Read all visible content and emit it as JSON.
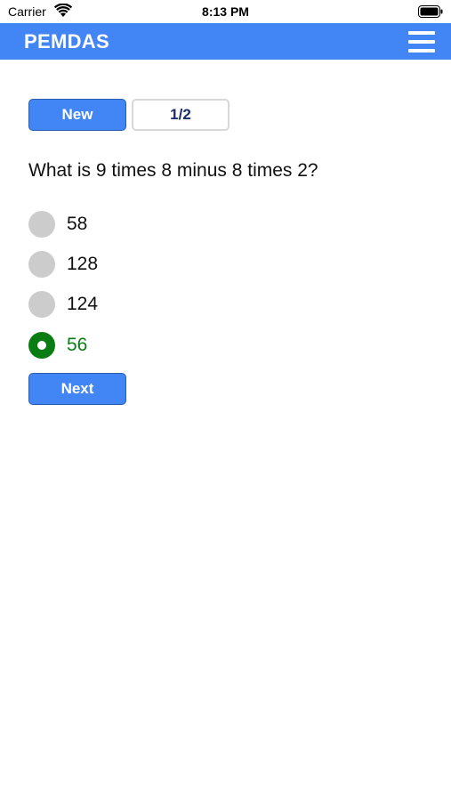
{
  "status_bar": {
    "carrier": "Carrier",
    "time": "8:13 PM",
    "icons": [
      "wifi-icon",
      "battery-icon"
    ]
  },
  "header": {
    "title": "PEMDAS",
    "menu_icon": "hamburger-menu-icon",
    "background_color": "#4285f4"
  },
  "controls": {
    "new_label": "New",
    "counter": "1/2"
  },
  "quiz": {
    "question": "What is 9 times 8 minus 8 times 2?",
    "options": [
      {
        "label": "58",
        "selected": false
      },
      {
        "label": "128",
        "selected": false
      },
      {
        "label": "124",
        "selected": false
      },
      {
        "label": "56",
        "selected": true
      }
    ],
    "selected_color": "#0a7c14",
    "unselected_color": "#cccccc",
    "next_label": "Next"
  }
}
